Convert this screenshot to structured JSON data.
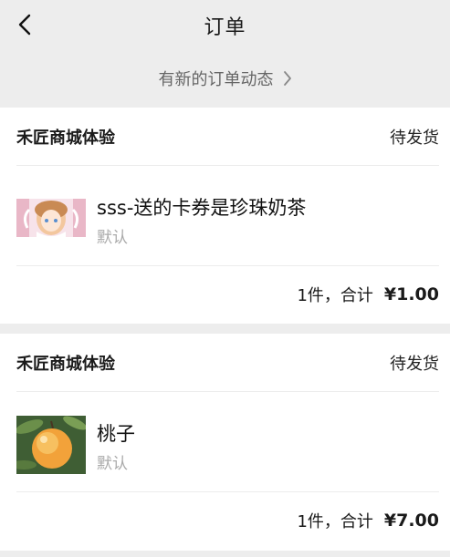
{
  "header": {
    "title": "订单",
    "back_icon": "chevron-left-icon"
  },
  "notice": {
    "label": "有新的订单动态",
    "icon": "chevron-right-icon"
  },
  "orders": [
    {
      "shop": "禾匠商城体验",
      "status": "待发货",
      "item_title": "sss-送的卡券是珍珠奶茶",
      "item_spec": "默认",
      "thumb": "anime-girl-image",
      "summary": "1件，合计",
      "price": "¥1.00"
    },
    {
      "shop": "禾匠商城体验",
      "status": "待发货",
      "item_title": "桃子",
      "item_spec": "默认",
      "thumb": "peach-image",
      "summary": "1件，合计",
      "price": "¥7.00"
    }
  ],
  "colors": {
    "background": "#ededed",
    "card": "#ffffff",
    "muted_text": "#aaaaaa"
  }
}
